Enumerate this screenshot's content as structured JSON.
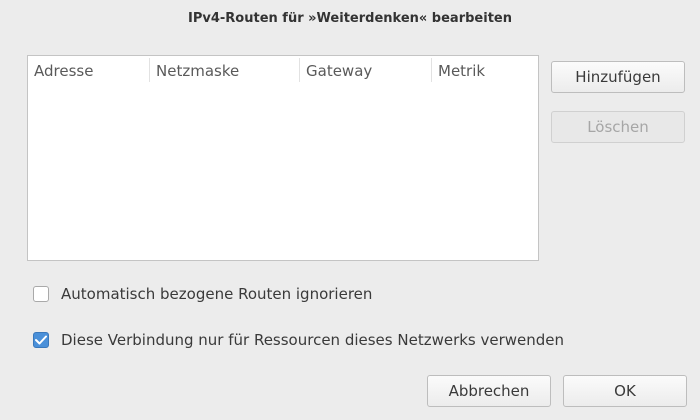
{
  "dialog": {
    "title": "IPv4-Routen für »Weiterdenken« bearbeiten"
  },
  "table": {
    "columns": [
      "Adresse",
      "Netzmaske",
      "Gateway",
      "Metrik"
    ],
    "rows": []
  },
  "buttons": {
    "add_label": "Hinzufügen",
    "delete_label": "Löschen",
    "cancel_label": "Abbrechen",
    "ok_label": "OK"
  },
  "options": {
    "ignore_auto_routes": {
      "label": "Automatisch bezogene Routen ignorieren",
      "checked": false
    },
    "only_network_resources": {
      "label": "Diese Verbindung nur für Ressourcen dieses Netzwerks verwenden",
      "checked": true
    }
  },
  "colors": {
    "accent": "#4a90d9",
    "background": "#ececec"
  }
}
